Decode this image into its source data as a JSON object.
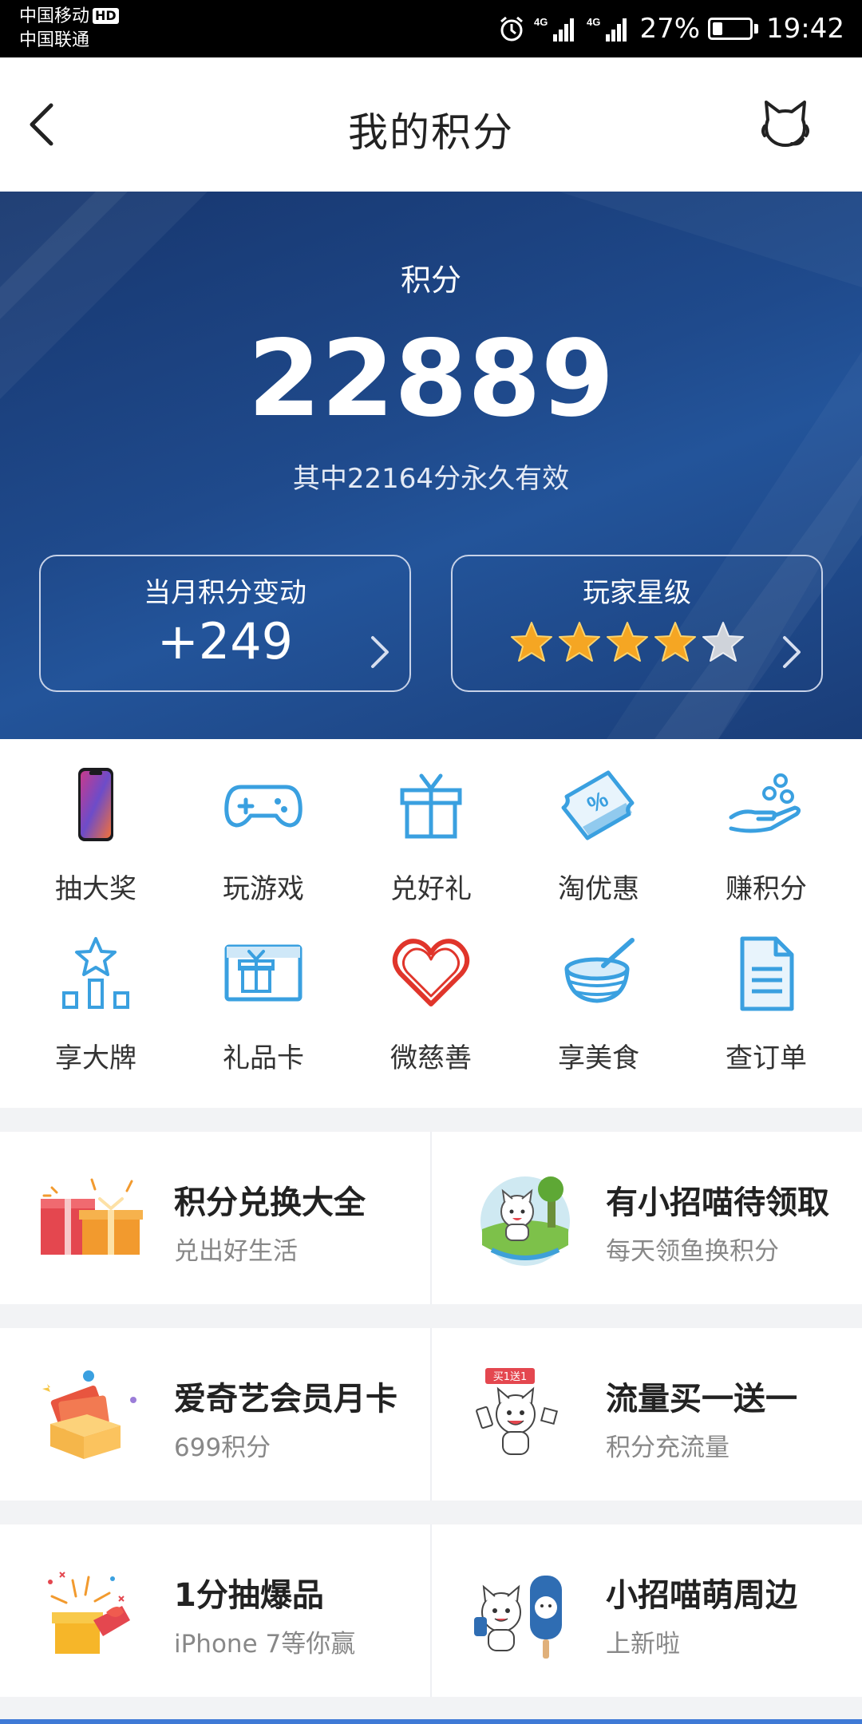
{
  "status_bar": {
    "carrier_1": "中国移动",
    "carrier_1_badge": "HD",
    "carrier_2": "中国联通",
    "network_1": "4G",
    "network_2": "4G",
    "battery": "27%",
    "battery_level": 0.27,
    "time": "19:42"
  },
  "header": {
    "title": "我的积分",
    "back_icon": "back-arrow-icon",
    "service_icon": "customer-service-cat-icon"
  },
  "hero": {
    "label": "积分",
    "points": "22889",
    "subtitle": "其中22164分永久有效",
    "monthly_card": {
      "title": "当月积分变动",
      "value": "+249"
    },
    "level_card": {
      "title": "玩家星级",
      "stars_filled": 4,
      "stars_total": 5
    },
    "colors": {
      "bg_dark": "#17366e",
      "bg_light": "#23549a",
      "star": "#f5a623"
    }
  },
  "grid": {
    "items": [
      {
        "label": "抽大奖",
        "icon": "phone-icon"
      },
      {
        "label": "玩游戏",
        "icon": "gamepad-icon"
      },
      {
        "label": "兑好礼",
        "icon": "gift-icon"
      },
      {
        "label": "淘优惠",
        "icon": "coupon-icon"
      },
      {
        "label": "赚积分",
        "icon": "hand-coins-icon"
      },
      {
        "label": "享大牌",
        "icon": "star-podium-icon"
      },
      {
        "label": "礼品卡",
        "icon": "gift-card-icon"
      },
      {
        "label": "微慈善",
        "icon": "heart-icon"
      },
      {
        "label": "享美食",
        "icon": "bowl-icon"
      },
      {
        "label": "查订单",
        "icon": "document-icon"
      }
    ],
    "accent": "#3aa0e0"
  },
  "promos": [
    {
      "title": "积分兑换大全",
      "sub": "兑出好生活",
      "icon": "gift-boxes-icon"
    },
    {
      "title": "有小招喵待领取",
      "sub": "每天领鱼换积分",
      "icon": "cat-island-icon"
    },
    {
      "title": "爱奇艺会员月卡",
      "sub": "699积分",
      "icon": "coupon-box-icon"
    },
    {
      "title": "流量买一送一",
      "sub": "积分充流量",
      "icon": "cat-badge-icon",
      "badge": "买1送1"
    },
    {
      "title": "1分抽爆品",
      "sub": "iPhone 7等你赢",
      "icon": "gift-burst-icon"
    },
    {
      "title": "小招喵萌周边",
      "sub": "上新啦",
      "icon": "cat-popsicle-icon"
    }
  ]
}
